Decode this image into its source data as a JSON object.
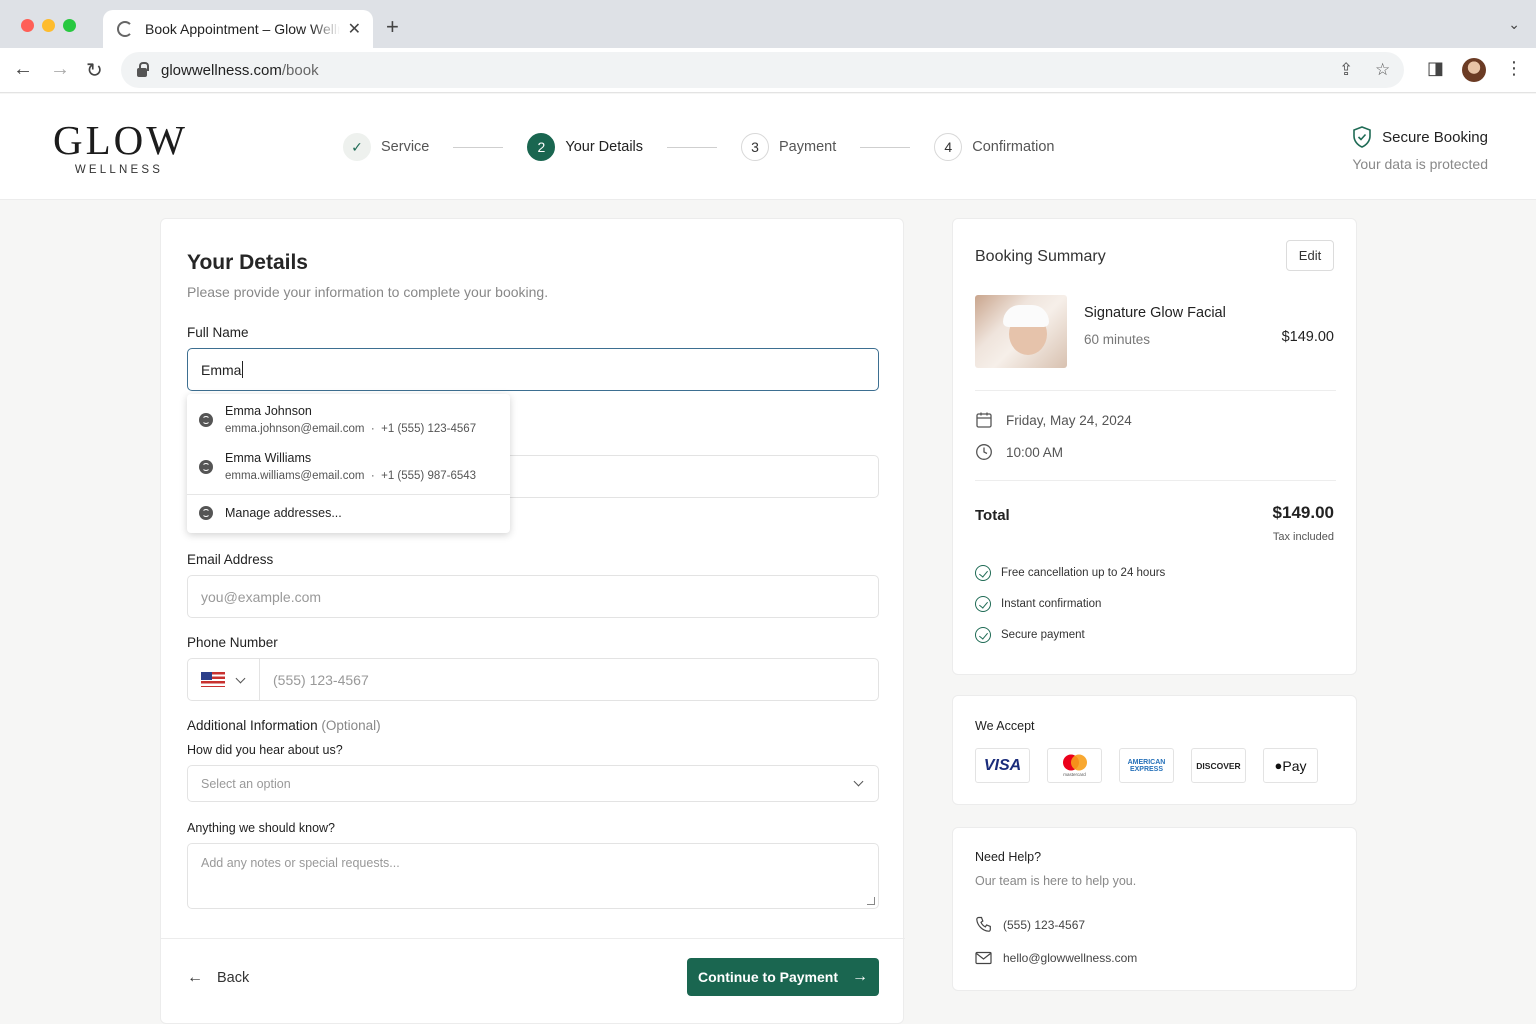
{
  "browser": {
    "tab_title": "Book Appointment – Glow Wellness",
    "url_host": "glowwellness.com",
    "url_path": "/book"
  },
  "brand": {
    "name": "GLOW",
    "tagline": "WELLNESS",
    "accent": "#1a6650"
  },
  "steps": [
    {
      "num": "✓",
      "label": "Service",
      "state": "done"
    },
    {
      "num": "2",
      "label": "Your Details",
      "state": "active"
    },
    {
      "num": "3",
      "label": "Payment",
      "state": "pending"
    },
    {
      "num": "4",
      "label": "Confirmation",
      "state": "pending"
    }
  ],
  "secure": {
    "title": "Secure Booking",
    "subtitle": "Your data is protected"
  },
  "form": {
    "title": "Your Details",
    "subtitle": "Please provide your information to complete your booking.",
    "full_name_label": "Full Name",
    "full_name_value": "Emma",
    "email_label": "Email Address",
    "email_placeholder": "you@example.com",
    "phone_label": "Phone Number",
    "phone_placeholder": "(555) 123-4567",
    "additional_label": "Additional Information",
    "additional_optional": "(Optional)",
    "hear_label": "How did you hear about us?",
    "hear_placeholder": "Select an option",
    "notes_label": "Anything we should know?",
    "notes_placeholder": "Add any notes or special requests...",
    "back_label": "Back",
    "continue_label": "Continue to Payment"
  },
  "autofill": {
    "items": [
      {
        "name": "Emma Johnson",
        "email": "emma.johnson@email.com",
        "phone": "+1 (555) 123-4567"
      },
      {
        "name": "Emma Williams",
        "email": "emma.williams@email.com",
        "phone": "+1 (555) 987-6543"
      }
    ],
    "manage_label": "Manage addresses..."
  },
  "summary": {
    "title": "Booking Summary",
    "edit_label": "Edit",
    "service_name": "Signature Glow Facial",
    "duration": "60 minutes",
    "price": "$149.00",
    "date": "Friday, May 24, 2024",
    "time": "10:00 AM",
    "total_label": "Total",
    "total_value": "$149.00",
    "tax_note": "Tax included",
    "perks": [
      "Free cancellation up to 24 hours",
      "Instant confirmation",
      "Secure payment"
    ]
  },
  "accept": {
    "title": "We Accept",
    "cards": [
      "VISA",
      "mastercard",
      "AMERICAN EXPRESS",
      "DISCOVER",
      "Pay"
    ]
  },
  "help": {
    "title": "Need Help?",
    "subtitle": "Our team is here to help you.",
    "phone": "(555) 123-4567",
    "email": "hello@glowwellness.com"
  }
}
